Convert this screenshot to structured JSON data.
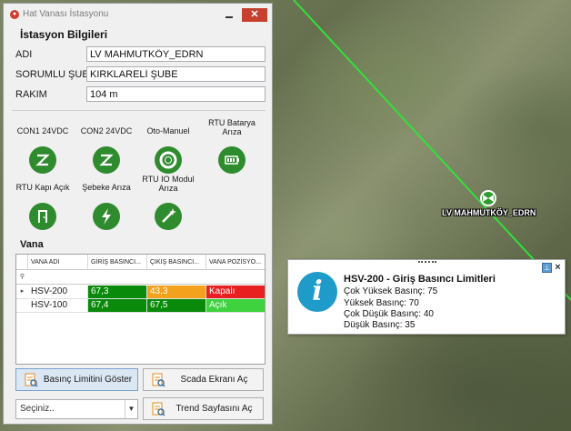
{
  "window": {
    "title": "Hat Vanası İstasyonu"
  },
  "station": {
    "section_title": "İstasyon Bilgileri",
    "fields": [
      {
        "label": "ADI",
        "value": "LV MAHMUTKÖY_EDRN"
      },
      {
        "label": "SORUMLU ŞUBE",
        "value": "KIRKLARELİ ŞUBE"
      },
      {
        "label": "RAKIM",
        "value": "104 m"
      }
    ]
  },
  "status_items": [
    {
      "label": "CON1 24VDC",
      "icon": "z-icon"
    },
    {
      "label": "CON2 24VDC",
      "icon": "z-icon"
    },
    {
      "label": "Oto-Manuel",
      "icon": "lifebuoy-icon"
    },
    {
      "label": "RTU Batarya Arıza",
      "icon": "battery-icon"
    },
    {
      "label": "RTU Kapı Açık",
      "icon": "door-icon"
    },
    {
      "label": "Şebeke Arıza",
      "icon": "lightning-icon"
    },
    {
      "label": "RTU IO Modul Arıza",
      "icon": "wand-icon"
    }
  ],
  "vana": {
    "title": "Vana",
    "columns": [
      "VANA ADI",
      "GİRİŞ BASINCI...",
      "ÇIKIŞ BASINCI...",
      "VANA POZİSYO..."
    ],
    "rows": [
      {
        "name": "HSV-200",
        "giris": "67,3",
        "cikis": "43,3",
        "pozisyon": "Kapalı",
        "giris_color": "#0a8a0a",
        "cikis_color": "#f4a21d",
        "poz_color": "#e82020"
      },
      {
        "name": "HSV-100",
        "giris": "67,4",
        "cikis": "67,5",
        "pozisyon": "Açık",
        "giris_color": "#0a8a0a",
        "cikis_color": "#0a8a0a",
        "poz_color": "#3ed23e"
      }
    ]
  },
  "buttons": {
    "limits": "Basınç Limitini Göster",
    "scada": "Scada Ekranı Aç",
    "trend": "Trend Sayfasını Aç"
  },
  "combo": {
    "value": "Seçiniz.."
  },
  "map": {
    "station_label": "LV MAHMUTKÖY_EDRN"
  },
  "tooltip": {
    "title": "HSV-200 - Giriş Basıncı Limitleri",
    "lines": [
      "Çok Yüksek Basınç: 75",
      "Yüksek Basınç: 70",
      "Çok Düşük Basınç: 40",
      "Düşük Basınç: 35"
    ]
  }
}
